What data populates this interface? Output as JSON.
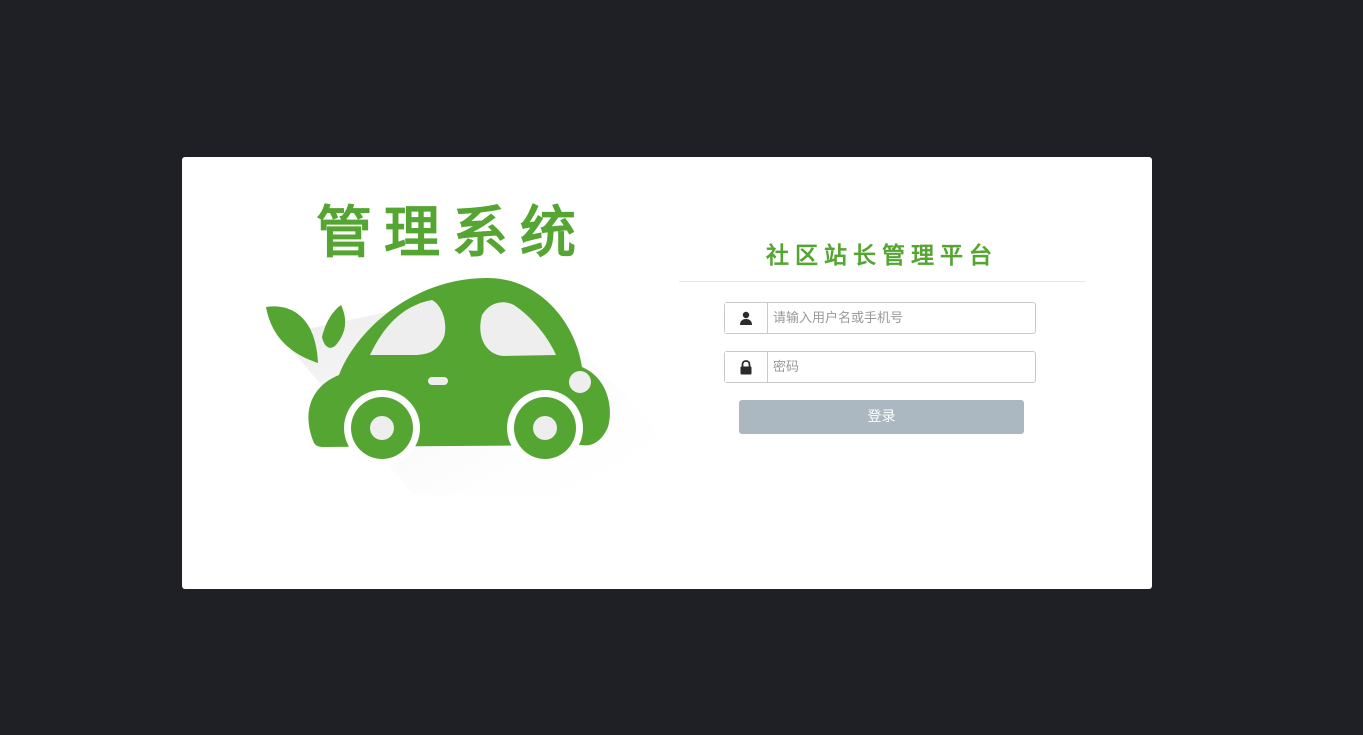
{
  "logo": {
    "title": "管理系统",
    "brand_color": "#55a532"
  },
  "platform": {
    "title": "社区站长管理平台"
  },
  "form": {
    "username": {
      "placeholder": "请输入用户名或手机号",
      "value": "",
      "icon": "user-icon"
    },
    "password": {
      "placeholder": "密码",
      "value": "",
      "icon": "lock-icon"
    },
    "submit_label": "登录",
    "submit_color": "#abb8c1"
  },
  "colors": {
    "background": "#1f2025",
    "card": "#ffffff"
  }
}
